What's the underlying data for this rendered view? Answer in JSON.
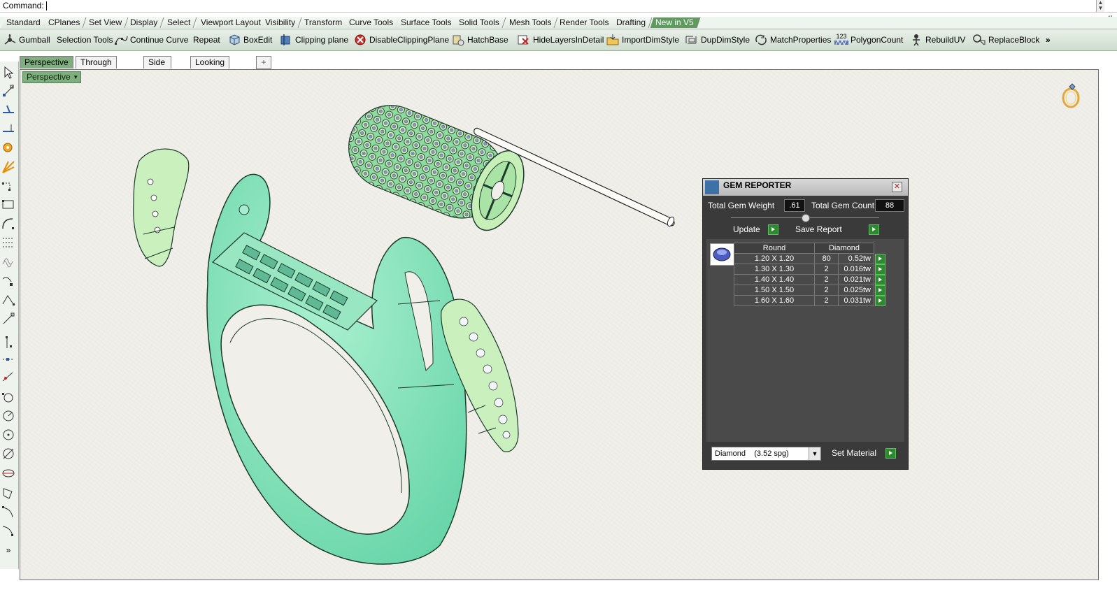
{
  "command": {
    "label": "Command:",
    "value": ""
  },
  "toolbar_tabs": [
    "Standard",
    "CPlanes",
    "Set View",
    "Display",
    "Select",
    "Viewport Layout",
    "Visibility",
    "Transform",
    "Curve Tools",
    "Surface Tools",
    "Solid Tools",
    "Mesh Tools",
    "Render Tools",
    "Drafting",
    "New in V5"
  ],
  "active_toolbar_tab": "New in V5",
  "toolbar_buttons": [
    {
      "label": "Gumball",
      "icon": "gumball-icon"
    },
    {
      "label": "Selection Tools",
      "icon": ""
    },
    {
      "label": "Continue Curve",
      "icon": "continue-curve-icon"
    },
    {
      "label": "Repeat",
      "icon": ""
    },
    {
      "label": "BoxEdit",
      "icon": "boxedit-icon"
    },
    {
      "label": "Clipping plane",
      "icon": "clipping-plane-icon"
    },
    {
      "label": "DisableClippingPlane",
      "icon": "disable-clipping-plane-icon"
    },
    {
      "label": "HatchBase",
      "icon": "hatchbase-icon"
    },
    {
      "label": "HideLayersInDetail",
      "icon": "hide-layers-icon"
    },
    {
      "label": "ImportDimStyle",
      "icon": "import-dimstyle-icon"
    },
    {
      "label": "DupDimStyle",
      "icon": "dup-dimstyle-icon"
    },
    {
      "label": "MatchProperties",
      "icon": "match-properties-icon"
    },
    {
      "label": "PolygonCount",
      "icon": "polygon-count-icon"
    },
    {
      "label": "RebuildUV",
      "icon": "rebuild-uv-icon"
    },
    {
      "label": "ReplaceBlock",
      "icon": "replace-block-icon"
    },
    {
      "label": "»",
      "icon": ""
    }
  ],
  "polygon_icon_text": "123",
  "viewport_tabs": [
    "Perspective",
    "Through Finger",
    "Side View",
    "Looking Down"
  ],
  "add_tab": "+",
  "viewport_label": "Perspective",
  "gem_reporter": {
    "title": "GEM REPORTER",
    "total_weight_label": "Total Gem Weight",
    "total_weight_value": ".61",
    "total_count_label": "Total Gem Count",
    "total_count_value": "88",
    "update_label": "Update",
    "save_label": "Save Report",
    "table_headers": [
      "Round",
      "Diamond"
    ],
    "rows": [
      {
        "size": "1.20 X 1.20",
        "count": "80",
        "weight": "0.52tw"
      },
      {
        "size": "1.30 X 1.30",
        "count": "2",
        "weight": "0.016tw"
      },
      {
        "size": "1.40 X 1.40",
        "count": "2",
        "weight": "0.021tw"
      },
      {
        "size": "1.50 X 1.50",
        "count": "2",
        "weight": "0.025tw"
      },
      {
        "size": "1.60 X 1.60",
        "count": "2",
        "weight": "0.031tw"
      }
    ],
    "material_value": "Diamond    (3.52 spg)",
    "set_material_label": "Set Material"
  }
}
